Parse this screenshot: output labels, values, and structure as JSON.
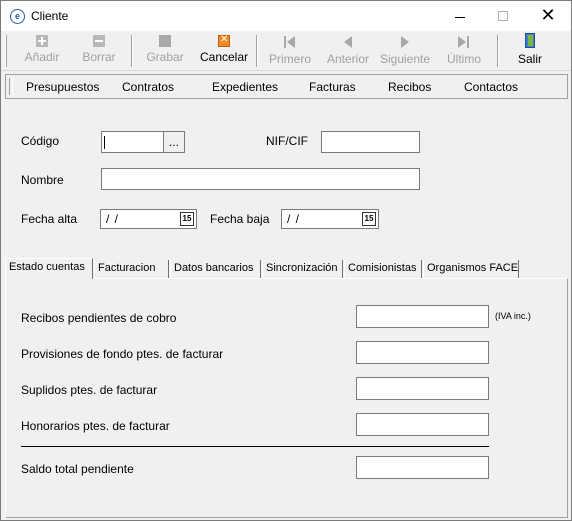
{
  "window": {
    "title": "Cliente",
    "app_icon_letter": "e"
  },
  "toolbar": {
    "add": "Añadir",
    "delete": "Borrar",
    "save": "Grabar",
    "cancel": "Cancelar",
    "first": "Primero",
    "prev": "Anterior",
    "next": "Siguiente",
    "last": "Último",
    "exit": "Salir"
  },
  "menu": {
    "items": [
      "Presupuestos",
      "Contratos",
      "Expedientes",
      "Facturas",
      "Recibos",
      "Contactos"
    ]
  },
  "form": {
    "codigo_label": "Código",
    "codigo_value": "",
    "ellipsis": "...",
    "nif_label": "NIF/CIF",
    "nif_value": "",
    "nombre_label": "Nombre",
    "nombre_value": "",
    "fecha_alta_label": "Fecha alta",
    "fecha_alta_value": "/ /",
    "fecha_baja_label": "Fecha baja",
    "fecha_baja_value": "/ /",
    "calendar_glyph": "15"
  },
  "tabs": {
    "items": [
      "Estado cuentas",
      "Facturacion",
      "Datos bancarios",
      "Sincronización",
      "Comisionistas",
      "Organismos FACE"
    ],
    "active": "Estado cuentas"
  },
  "estado": {
    "recibos_label": "Recibos pendientes de cobro",
    "recibos_value": "",
    "iva_note": "(IVA inc.)",
    "provisiones_label": "Provisiones de fondo ptes. de facturar",
    "provisiones_value": "",
    "suplidos_label": "Suplidos ptes. de facturar",
    "suplidos_value": "",
    "honorarios_label": "Honorarios ptes. de facturar",
    "honorarios_value": "",
    "saldo_label": "Saldo total pendiente",
    "saldo_value": ""
  },
  "colors": {
    "window_bg": "#f0f0f0",
    "titlebar_bg": "#ffffff",
    "cancel_icon": "#f08a24",
    "exit_icon": "#3f7fd0"
  }
}
